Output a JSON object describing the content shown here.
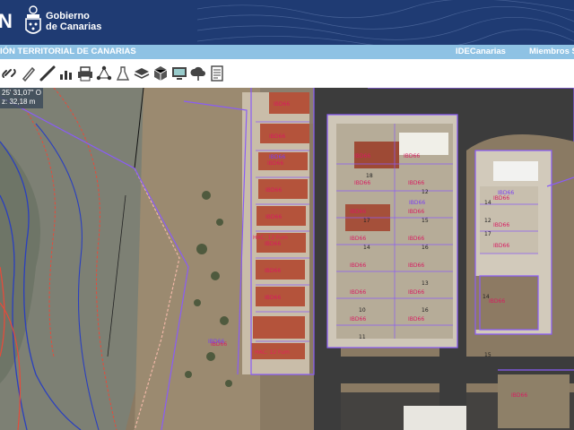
{
  "header": {
    "brand_fragment": "N",
    "gov_line1": "Gobierno",
    "gov_line2": "de Canarias"
  },
  "navbar": {
    "title": "IÓN TERRITORIAL DE CANARIAS",
    "link_ide": "IDECanarias",
    "link_members": "Miembros S"
  },
  "toolbar": {
    "tools": [
      "link-icon",
      "pencil-icon",
      "ruler-icon",
      "chart-icon",
      "print-icon",
      "network-icon",
      "flask-icon",
      "layers-icon",
      "cube-icon",
      "monitor-icon",
      "cloud-icon",
      "document-icon"
    ]
  },
  "coords": {
    "lon": "25' 31,07\" O",
    "z": "z: 32,18 m"
  },
  "map": {
    "labels": [
      "HAC. 12 Fum",
      "HAC. 12 Fum",
      "IBD66",
      "IBD66",
      "IBD66",
      "IBD66"
    ],
    "parcel_numbers": [
      "18",
      "12",
      "17",
      "14",
      "15",
      "16",
      "11",
      "10",
      "13",
      "14",
      "12",
      "17",
      "14",
      "15",
      "16"
    ]
  },
  "colors": {
    "header": "#1f3b73",
    "navbar": "#8ec2e4",
    "parcel_line": "#8a5cf6",
    "contour_red": "#e54b3b",
    "contour_blue": "#2a3fbf"
  }
}
